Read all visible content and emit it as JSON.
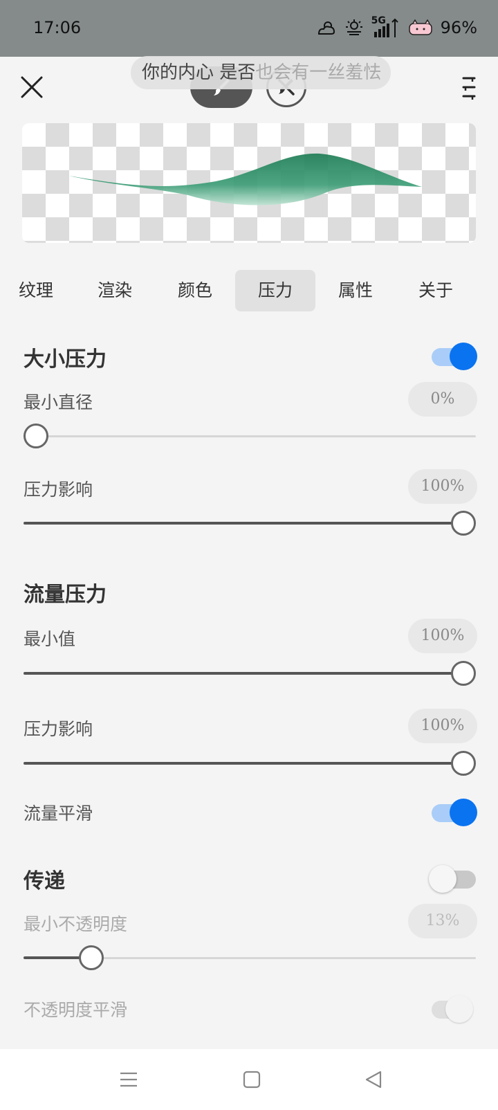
{
  "status": {
    "time": "17:06",
    "network": "5G",
    "battery": "96%"
  },
  "toast": {
    "text": "你的内心 是否",
    "faded": "也会有一丝羞怯"
  },
  "tabs": [
    {
      "label": "纹理"
    },
    {
      "label": "渲染"
    },
    {
      "label": "颜色"
    },
    {
      "label": "压力",
      "active": true
    },
    {
      "label": "属性"
    },
    {
      "label": "关于"
    }
  ],
  "size_pressure": {
    "title": "大小压力",
    "enabled": true,
    "min_diameter": {
      "label": "最小直径",
      "value": "0%",
      "fraction": 0.0
    },
    "pressure_effect": {
      "label": "压力影响",
      "value": "100%",
      "fraction": 1.0
    }
  },
  "flow_pressure": {
    "title": "流量压力",
    "min_value": {
      "label": "最小值",
      "value": "100%",
      "fraction": 1.0
    },
    "pressure_effect": {
      "label": "压力影响",
      "value": "100%",
      "fraction": 1.0
    },
    "flow_smoothing": {
      "label": "流量平滑",
      "enabled": true
    }
  },
  "transfer": {
    "title": "传递",
    "enabled": false,
    "min_opacity": {
      "label": "最小不透明度",
      "value": "13%",
      "fraction": 0.13
    },
    "opacity_smoothing": {
      "label": "不透明度平滑",
      "enabled": true
    }
  },
  "colors": {
    "accent": "#0a73f0",
    "stroke_green": "#2e8b66",
    "status_bar": "#858b8b"
  },
  "icons": {
    "close": "close-icon",
    "menu": "menu-icon",
    "brush": "brush-icon",
    "eraser": "eraser-icon"
  }
}
